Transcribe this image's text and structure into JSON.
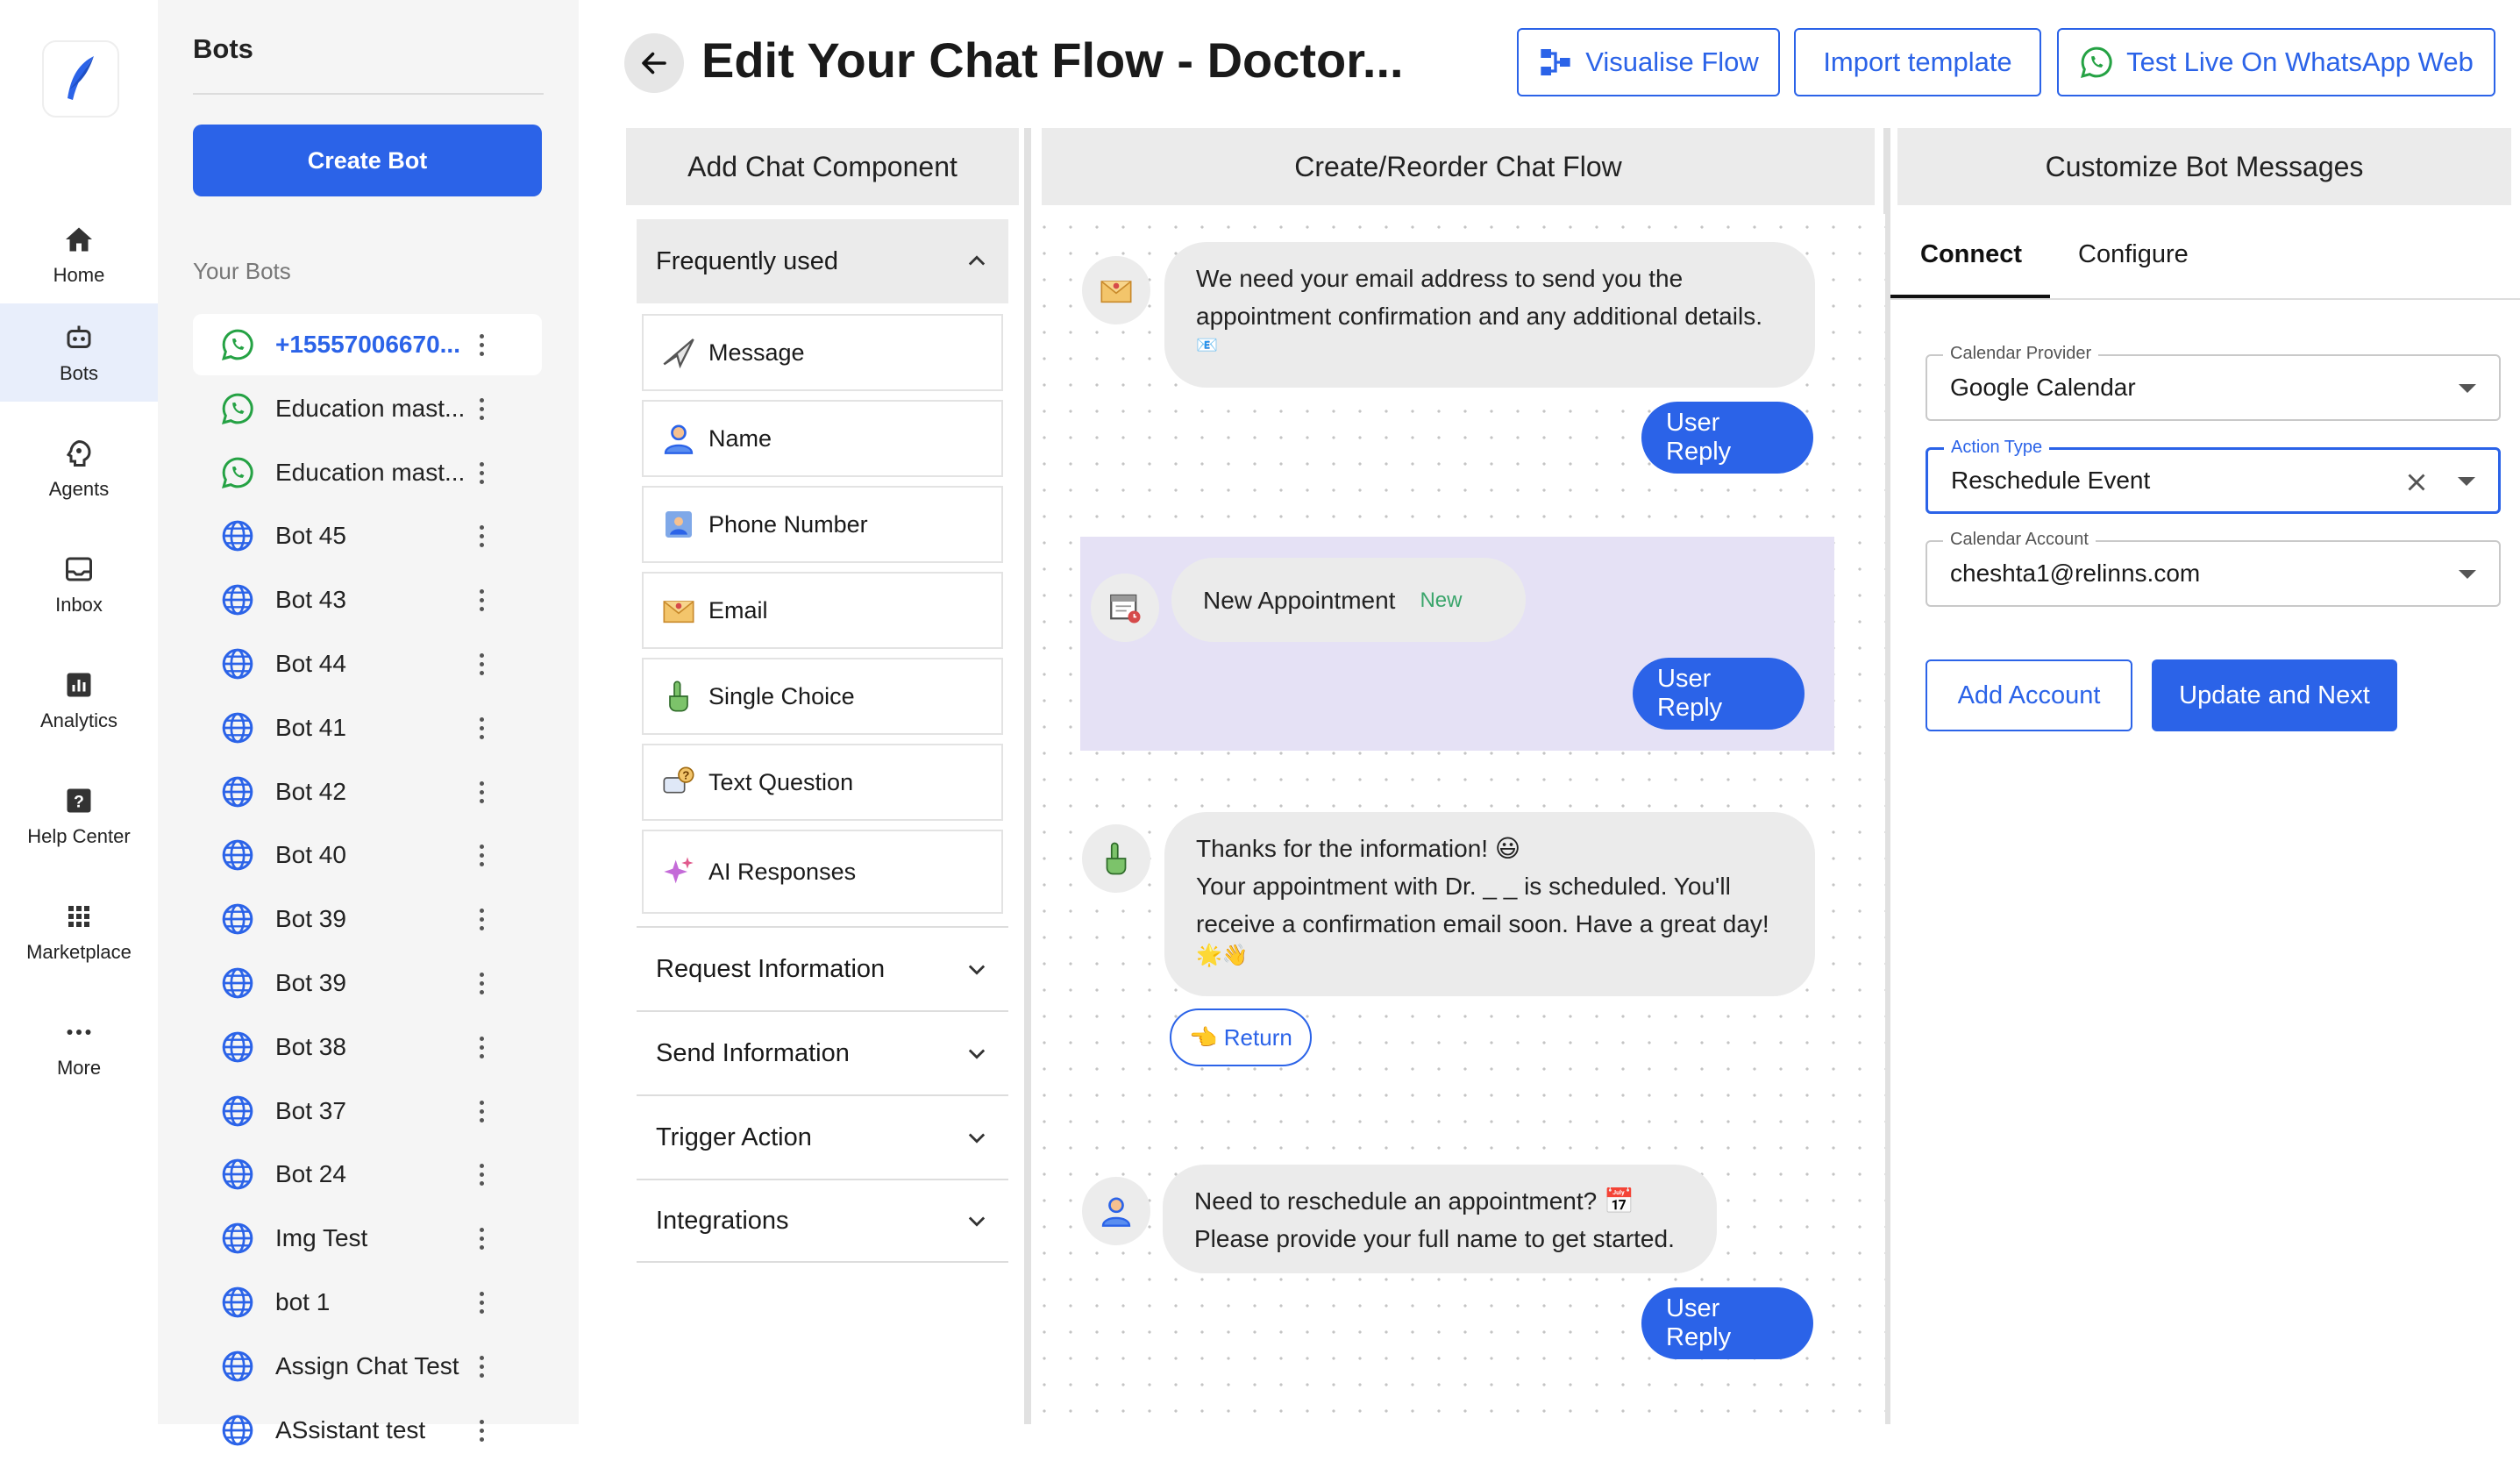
{
  "nav": {
    "items": [
      {
        "label": "Home",
        "icon": "home-icon"
      },
      {
        "label": "Bots",
        "icon": "robot-icon"
      },
      {
        "label": "Agents",
        "icon": "agent-icon"
      },
      {
        "label": "Inbox",
        "icon": "inbox-icon"
      },
      {
        "label": "Analytics",
        "icon": "analytics-icon"
      },
      {
        "label": "Help Center",
        "icon": "help-icon"
      },
      {
        "label": "Marketplace",
        "icon": "grid-icon"
      },
      {
        "label": "More",
        "icon": "more-icon"
      }
    ],
    "active": "Bots"
  },
  "bots_panel": {
    "title": "Bots",
    "create_label": "Create Bot",
    "section_label": "Your Bots",
    "bots": [
      {
        "name": "+15557006670...",
        "type": "whatsapp",
        "selected": true
      },
      {
        "name": "Education mast...",
        "type": "whatsapp"
      },
      {
        "name": "Education mast...",
        "type": "whatsapp"
      },
      {
        "name": "Bot 45",
        "type": "web"
      },
      {
        "name": "Bot 43",
        "type": "web"
      },
      {
        "name": "Bot 44",
        "type": "web"
      },
      {
        "name": "Bot 41",
        "type": "web"
      },
      {
        "name": "Bot 42",
        "type": "web"
      },
      {
        "name": "Bot 40",
        "type": "web"
      },
      {
        "name": "Bot 39",
        "type": "web"
      },
      {
        "name": "Bot 39",
        "type": "web"
      },
      {
        "name": "Bot 38",
        "type": "web"
      },
      {
        "name": "Bot 37",
        "type": "web"
      },
      {
        "name": "Bot 24",
        "type": "web"
      },
      {
        "name": "Img Test",
        "type": "web"
      },
      {
        "name": "bot 1",
        "type": "web"
      },
      {
        "name": "Assign Chat Test",
        "type": "web"
      },
      {
        "name": "ASsistant test",
        "type": "web"
      }
    ]
  },
  "header": {
    "title": "Edit Your Chat Flow - Doctor...",
    "visualise_label": "Visualise Flow",
    "import_label": "Import template",
    "test_label": "Test Live On WhatsApp Web"
  },
  "columns": {
    "add": "Add Chat Component",
    "create": "Create/Reorder Chat Flow",
    "customize": "Customize Bot Messages"
  },
  "components": {
    "frequent_label": "Frequently used",
    "items": [
      {
        "label": "Message",
        "icon": "paper-plane-icon"
      },
      {
        "label": "Name",
        "icon": "person-icon"
      },
      {
        "label": "Phone Number",
        "icon": "contact-card-icon"
      },
      {
        "label": "Email",
        "icon": "envelope-icon"
      },
      {
        "label": "Single Choice",
        "icon": "pointing-hand-icon"
      },
      {
        "label": "Text Question",
        "icon": "question-bubble-icon"
      },
      {
        "label": "AI Responses",
        "icon": "sparkles-icon"
      }
    ],
    "sections": [
      "Request Information",
      "Send Information",
      "Trigger Action",
      "Integrations"
    ]
  },
  "flow": {
    "nodes": [
      {
        "text_line1": "We need your email address to send you the",
        "text_line2": "appointment confirmation and any additional details.",
        "text_line3": "📧",
        "reply": "User Reply",
        "icon": "envelope-icon"
      },
      {
        "text_line1": "New Appointment",
        "tag": "New",
        "reply": "User Reply",
        "icon": "calendar-icon"
      },
      {
        "text_line1": "Thanks for the information! 😃",
        "text_line2": "Your appointment with Dr. _ _ is scheduled. You'll",
        "text_line3": "receive a confirmation email soon. Have a great day!",
        "text_line4": "🌟👋",
        "return_label": "👈 Return",
        "icon": "pointing-hand-icon"
      },
      {
        "text_line1": "Need to reschedule an appointment? 📅",
        "text_line2": "Please provide your full name to get started.",
        "reply": "User Reply",
        "icon": "person-icon"
      }
    ]
  },
  "customize": {
    "tabs": [
      "Connect",
      "Configure"
    ],
    "active_tab": "Connect",
    "fields": [
      {
        "label": "Calendar Provider",
        "value": "Google Calendar"
      },
      {
        "label": "Action Type",
        "value": "Reschedule Event"
      },
      {
        "label": "Calendar Account",
        "value": "cheshta1@relinns.com"
      }
    ],
    "add_account_label": "Add Account",
    "update_label": "Update and Next"
  },
  "colors": {
    "accent": "#2b63e8",
    "whatsapp": "#25a244",
    "highlight": "#e5e1f5"
  }
}
